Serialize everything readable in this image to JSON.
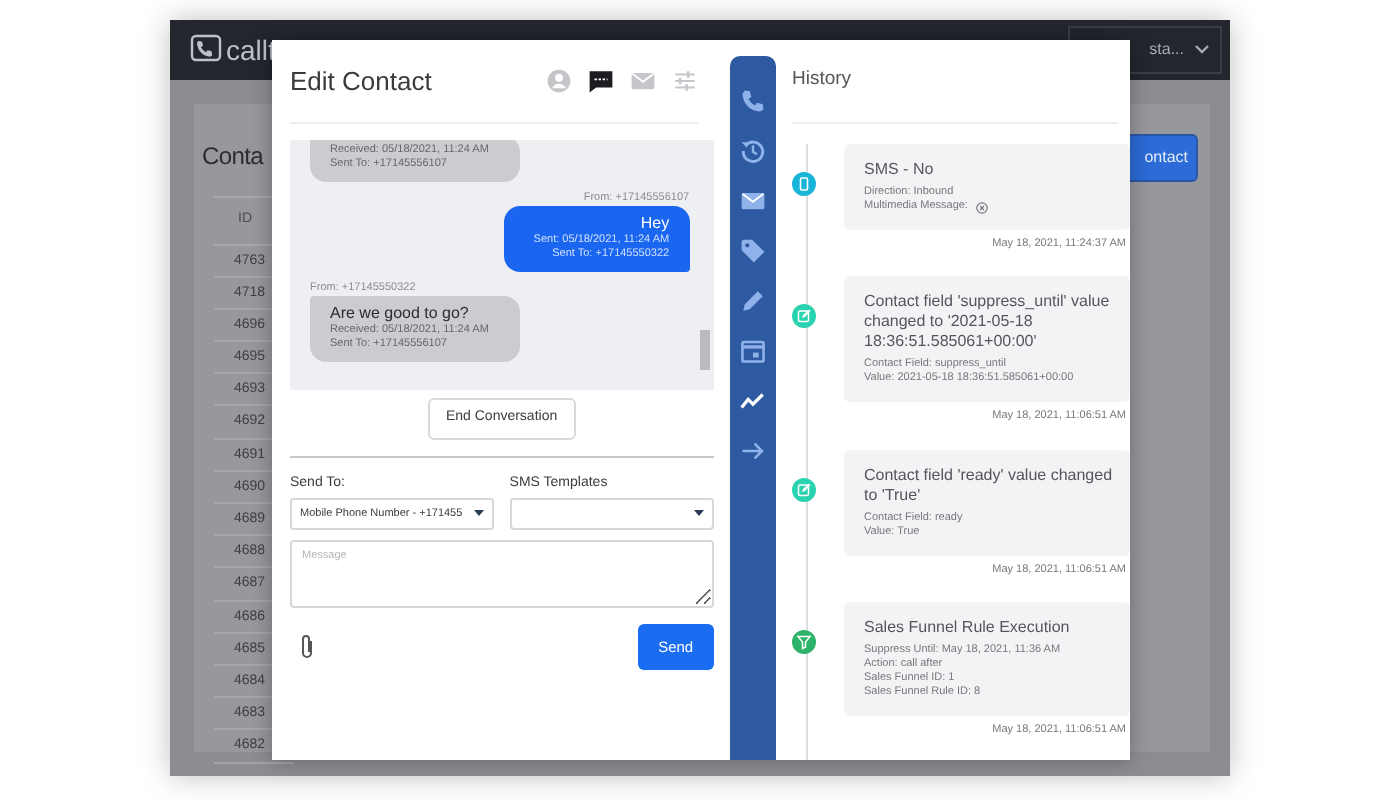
{
  "background_page": {
    "logo": "callt",
    "account_menu": "sta...",
    "heading": "Conta",
    "add_button": "ontact",
    "table": {
      "columns": [
        "ID"
      ],
      "rows": [
        [
          "4763"
        ],
        [
          "4718"
        ],
        [
          "4696"
        ],
        [
          "4695"
        ],
        [
          "4693"
        ],
        [
          "4692"
        ],
        [
          "4691"
        ],
        [
          "4690"
        ],
        [
          "4689"
        ],
        [
          "4688"
        ],
        [
          "4687"
        ],
        [
          "4686"
        ],
        [
          "4685"
        ],
        [
          "4684"
        ],
        [
          "4683"
        ],
        [
          "4682"
        ]
      ]
    }
  },
  "modal": {
    "title": "Edit Contact",
    "tabs": [
      {
        "kind": "person",
        "selected": false
      },
      {
        "kind": "chat",
        "selected": true
      },
      {
        "kind": "mail",
        "selected": false
      },
      {
        "kind": "sliders",
        "selected": false
      }
    ],
    "messages": [
      {
        "kind": "inbound",
        "lines": [
          "Received: 05/18/2021, 11:24 AM",
          "Sent To: +17145556107"
        ]
      },
      {
        "kind": "outbound",
        "from": "From: +17145556107",
        "text": "Hey",
        "lines": [
          "Sent: 05/18/2021, 11:24 AM",
          "Sent To: +17145550322"
        ]
      },
      {
        "kind": "inbound",
        "from": "From: +17145550322",
        "text": "Are we good to go?",
        "lines": [
          "Received: 05/18/2021, 11:24 AM",
          "Sent To: +17145556107"
        ]
      }
    ],
    "end_button": "End Conversation",
    "send_to": {
      "label": "Send To:",
      "value": "Mobile Phone Number - +171455"
    },
    "sms_templates": {
      "label": "SMS Templates"
    },
    "message": {
      "placeholder": "Message"
    },
    "send_button": "Send",
    "side_nav": [
      {
        "kind": "phone",
        "selected": false
      },
      {
        "kind": "history",
        "selected": false
      },
      {
        "kind": "mail",
        "selected": false
      },
      {
        "kind": "tag",
        "selected": false
      },
      {
        "kind": "pencil",
        "selected": false
      },
      {
        "kind": "calendar",
        "selected": false
      },
      {
        "kind": "chart",
        "selected": true
      },
      {
        "kind": "arrow",
        "selected": false
      }
    ],
    "history": {
      "title": "History",
      "items": [
        {
          "kind": "sms",
          "color": "#1ab4d8",
          "title": "SMS - No",
          "details": [
            "Direction: Inbound",
            "Multimedia Message:"
          ],
          "time": "May 18, 2021, 11:24:37 AM"
        },
        {
          "kind": "edit",
          "color": "#2ad3b0",
          "title": "Contact field 'suppress_until' value changed to '2021-05-18 18:36:51.585061+00:00'",
          "details": [
            "Contact Field: suppress_until",
            "Value: 2021-05-18 18:36:51.585061+00:00"
          ],
          "time": "May 18, 2021, 11:06:51 AM"
        },
        {
          "kind": "edit",
          "color": "#2ad3b0",
          "title": "Contact field 'ready' value changed to 'True'",
          "details": [
            "Contact Field: ready",
            "Value: True"
          ],
          "time": "May 18, 2021, 11:06:51 AM"
        },
        {
          "kind": "funnel",
          "color": "#2db36a",
          "title": "Sales Funnel Rule Execution",
          "details": [
            "Suppress Until: May 18, 2021, 11:36 AM",
            "Action: call after",
            "Sales Funnel ID: 1",
            "Sales Funnel Rule ID: 8"
          ],
          "time": "May 18, 2021, 11:06:51 AM"
        }
      ]
    }
  }
}
